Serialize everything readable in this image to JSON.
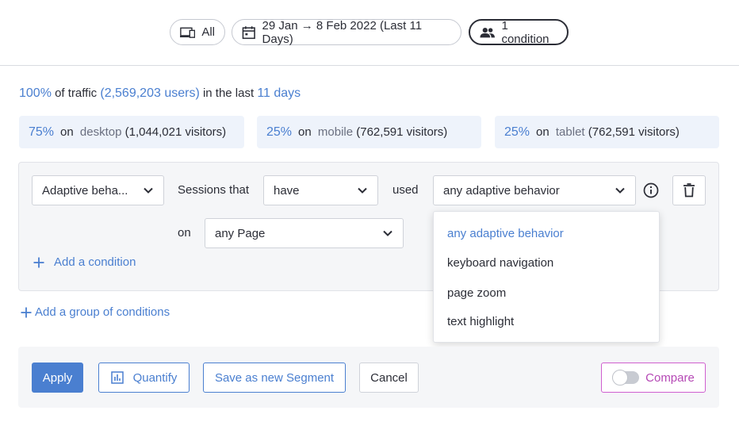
{
  "filters": {
    "device": "All",
    "date_range": "29 Jan → 8 Feb 2022 (Last 11 Days)",
    "conditions": "1 condition"
  },
  "traffic": {
    "percent": "100%",
    "of_traffic": "of traffic",
    "users": "(2,569,203 users)",
    "in_last": "in the last",
    "days": "11 days"
  },
  "devices": [
    {
      "pct": "75%",
      "on": "on",
      "kind": "desktop",
      "visitors": "(1,044,021 visitors)"
    },
    {
      "pct": "25%",
      "on": "on",
      "kind": "mobile",
      "visitors": "(762,591 visitors)"
    },
    {
      "pct": "25%",
      "on": "on",
      "kind": "tablet",
      "visitors": "(762,591 visitors)"
    }
  ],
  "condition": {
    "type_value": "Adaptive beha...",
    "sessions_that": "Sessions that",
    "have_value": "have",
    "used": "used",
    "behavior_value": "any adaptive behavior",
    "on": "on",
    "page_value": "any Page",
    "add_condition": "Add a condition"
  },
  "dropdown": {
    "options": [
      "any adaptive behavior",
      "keyboard navigation",
      "page zoom",
      "text highlight"
    ],
    "selected_index": 0
  },
  "add_group": "Add a group of conditions",
  "footer": {
    "apply": "Apply",
    "quantify": "Quantify",
    "save_segment": "Save as new Segment",
    "cancel": "Cancel",
    "compare": "Compare"
  },
  "colors": {
    "accent": "#4a7fd0",
    "compare": "#b548b5"
  }
}
